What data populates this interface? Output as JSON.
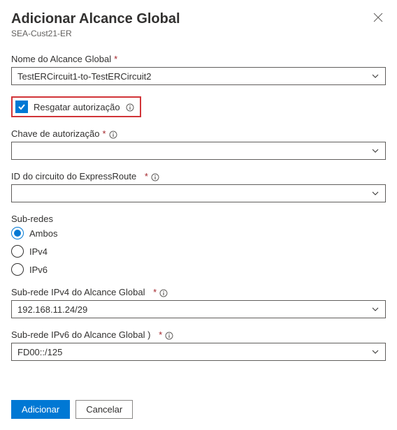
{
  "header": {
    "title": "Adicionar Alcance Global",
    "subtitle": "SEA-Cust21-ER"
  },
  "fields": {
    "name": {
      "label": "Nome do Alcance Global",
      "required": "*",
      "value": "TestERCircuit1-to-TestERCircuit2"
    },
    "redeem": {
      "label": "Resgatar autorização"
    },
    "authkey": {
      "label": "Chave de autorização",
      "required": "*",
      "value": ""
    },
    "circuitid": {
      "label": "ID do circuito do ExpressRoute",
      "required": "*",
      "value": ""
    },
    "subnets": {
      "label": "Sub-redes",
      "options": {
        "both": "Ambos",
        "ipv4": "IPv4",
        "ipv6": "IPv6"
      }
    },
    "ipv4subnet": {
      "label": "Sub-rede IPv4 do Alcance Global",
      "required": "*",
      "value": "192.168.11.24/29"
    },
    "ipv6subnet": {
      "label": "Sub-rede IPv6 do Alcance Global )",
      "required": "*",
      "value": "FD00::/125"
    }
  },
  "footer": {
    "add": "Adicionar",
    "cancel": "Cancelar"
  }
}
